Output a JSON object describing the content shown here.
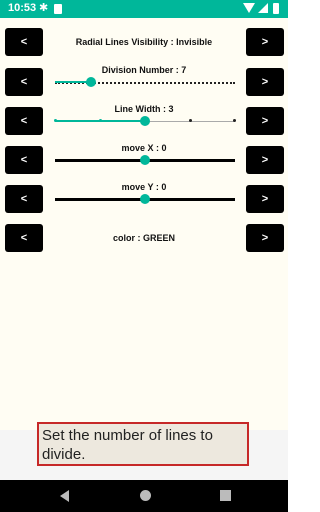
{
  "status": {
    "time": "10:53",
    "icons": [
      "gear-icon",
      "sd-card-icon",
      "wifi-icon",
      "signal-icon",
      "battery-icon"
    ]
  },
  "controls": {
    "prev_label": "<",
    "next_label": ">",
    "radial": {
      "label": "Radial Lines Visibility : Invisible"
    },
    "division": {
      "label": "Division Number : 7",
      "value": 7
    },
    "line_width": {
      "label": "Line Width : 3",
      "value": 3
    },
    "move_x": {
      "label": "move X : 0",
      "value": 0
    },
    "move_y": {
      "label": "move Y : 0",
      "value": 0
    },
    "color": {
      "label": "color : GREEN"
    }
  },
  "hint": {
    "text": "Set the number of lines to divide."
  },
  "colors": {
    "accent": "#00b79a",
    "hint_border": "#c62828",
    "background": "#fffdf3"
  }
}
